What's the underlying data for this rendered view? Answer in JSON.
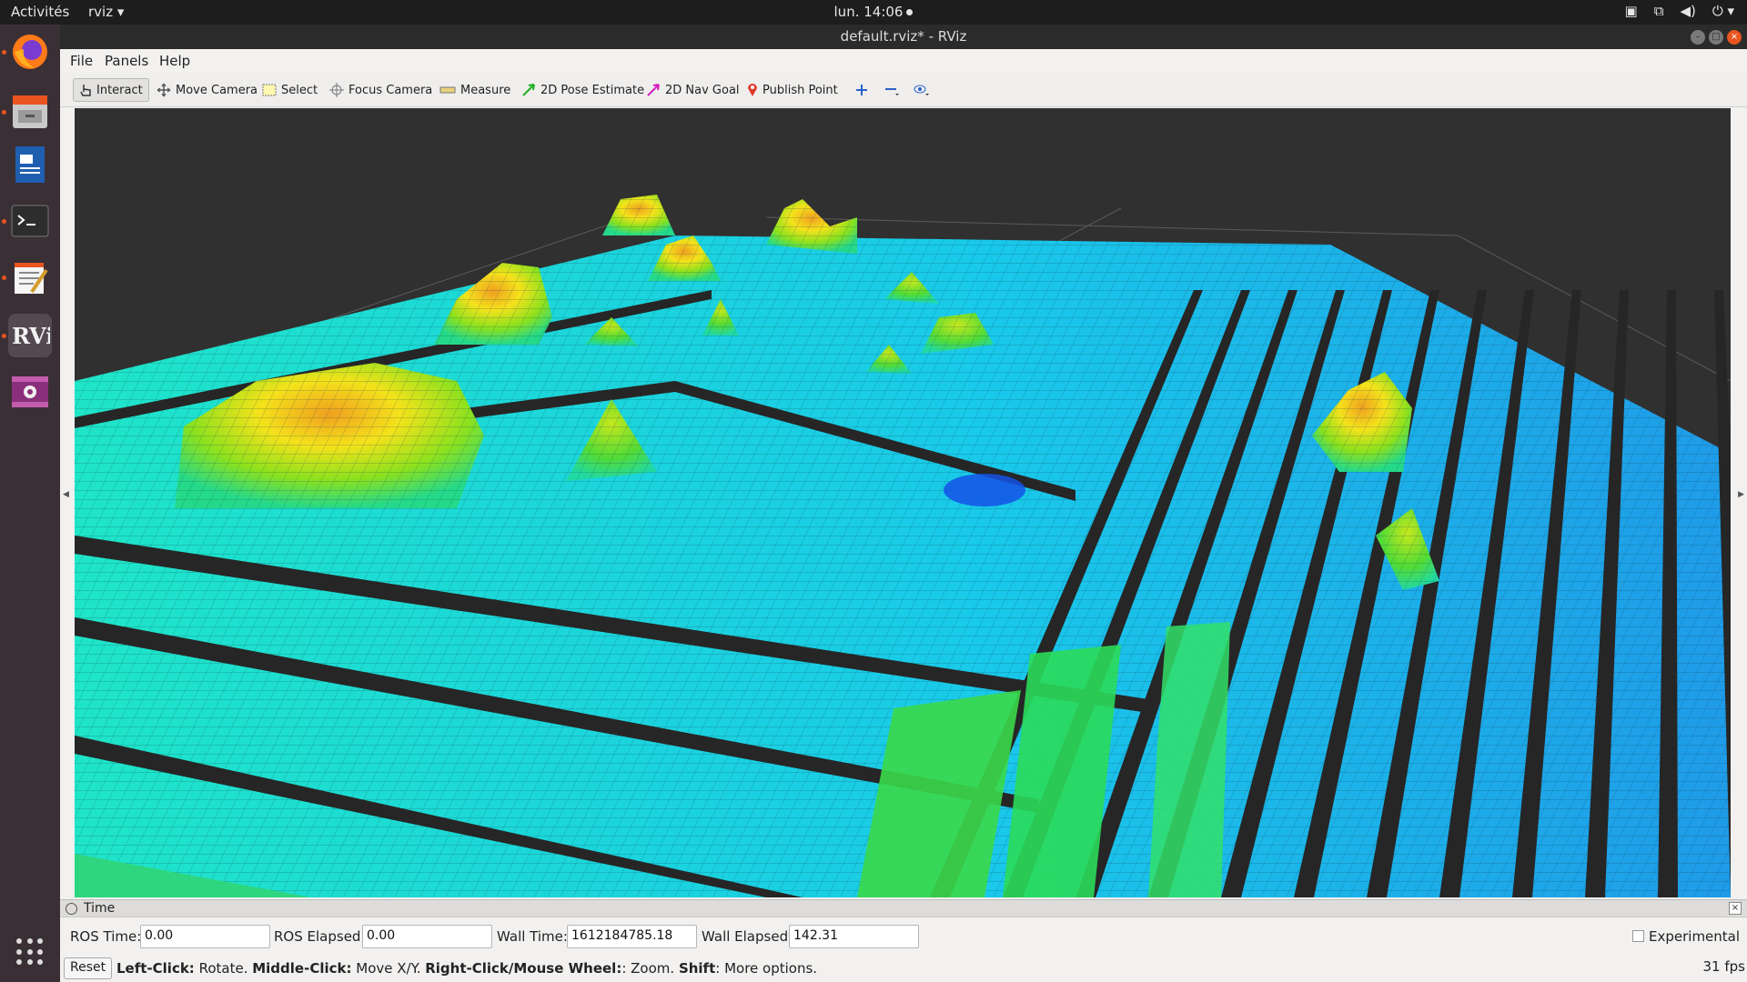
{
  "topbar": {
    "activities": "Activités",
    "app": "rviz ▾",
    "clock": "lun. 14:06"
  },
  "window": {
    "title": "default.rviz* - RViz"
  },
  "menu": {
    "file": "File",
    "panels": "Panels",
    "help": "Help"
  },
  "toolbar": {
    "interact": "Interact",
    "move_camera": "Move Camera",
    "select": "Select",
    "focus_camera": "Focus Camera",
    "measure": "Measure",
    "pose_estimate": "2D Pose Estimate",
    "nav_goal": "2D Nav Goal",
    "publish_point": "Publish Point"
  },
  "time_panel": {
    "title": "Time",
    "ros_time_label": "ROS Time:",
    "ros_time": "0.00",
    "ros_elapsed_label": "ROS Elapsed:",
    "ros_elapsed": "0.00",
    "wall_time_label": "Wall Time:",
    "wall_time": "1612184785.18",
    "wall_elapsed_label": "Wall Elapsed:",
    "wall_elapsed": "142.31",
    "experimental": "Experimental"
  },
  "status": {
    "reset": "Reset",
    "left_click": "Left-Click:",
    "left_click_desc": " Rotate. ",
    "middle_click": "Middle-Click:",
    "middle_click_desc": " Move X/Y. ",
    "right_click": "Right-Click/Mouse Wheel:",
    "right_click_desc": ": Zoom. ",
    "shift": "Shift",
    "shift_desc": ": More options.",
    "fps": "31 fps"
  },
  "colors": {
    "accent": "#e95420",
    "dock": "#3b2f36"
  }
}
